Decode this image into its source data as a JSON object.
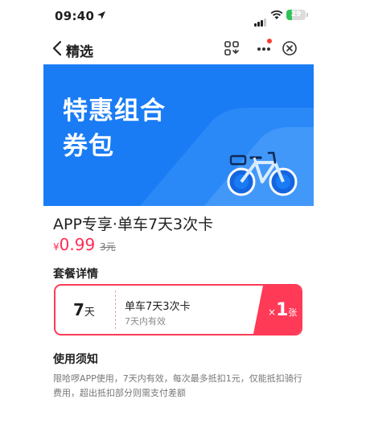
{
  "status_bar": {
    "time": "09:40",
    "battery": "29",
    "battery_level": 0.29
  },
  "nav": {
    "title": "精选"
  },
  "banner": {
    "line1": "特惠组合",
    "line2": "券包"
  },
  "product": {
    "title": "APP专享·单车7天3次卡",
    "currency": "¥",
    "price": "0.99",
    "original_price": "3元"
  },
  "details": {
    "heading": "套餐详情"
  },
  "coupon": {
    "days_value": "7",
    "days_unit": "天",
    "name": "单车7天3次卡",
    "validity": "7天内有效",
    "qty_prefix": "×",
    "qty": "1",
    "qty_unit": "张"
  },
  "usage": {
    "heading": "使用须知",
    "text": "限哈啰APP使用，7天内有效，每次最多抵扣1元，仅能抵扣骑行费用，超出抵扣部分则需支付差额"
  },
  "colors": {
    "accent_red": "#ff3a57",
    "banner_blue": "#1a7cf5"
  }
}
